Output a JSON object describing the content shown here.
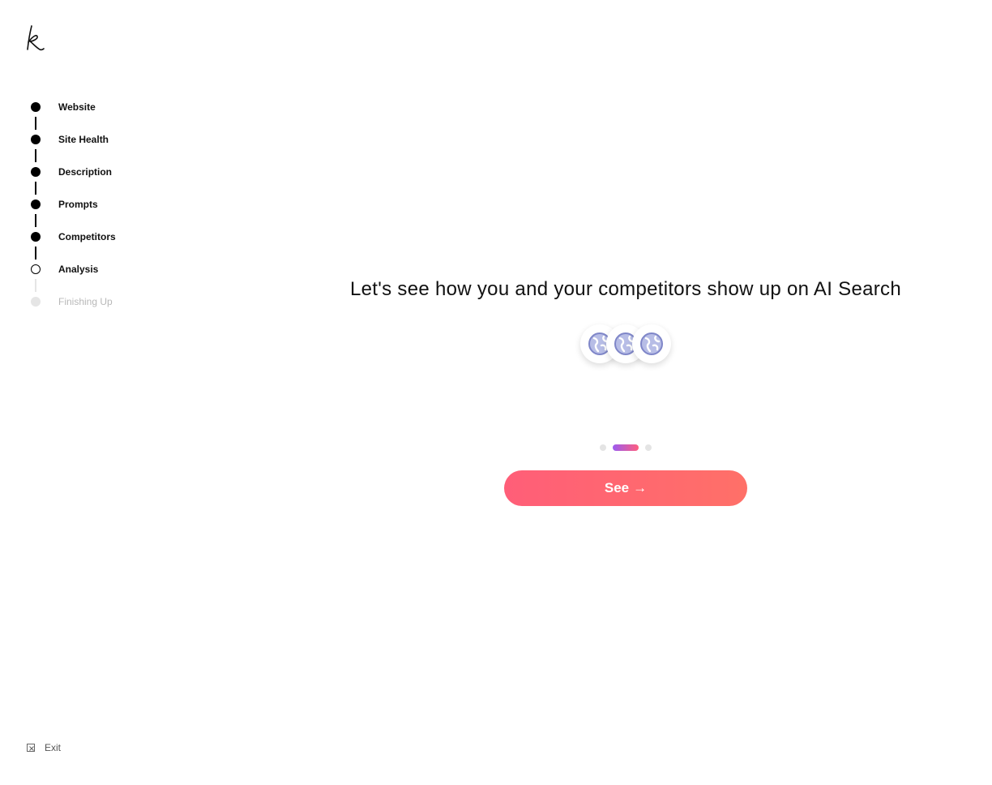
{
  "sidebar": {
    "logo": "k",
    "steps": [
      {
        "label": "Website",
        "status": "done"
      },
      {
        "label": "Site Health",
        "status": "done"
      },
      {
        "label": "Description",
        "status": "done"
      },
      {
        "label": "Prompts",
        "status": "done"
      },
      {
        "label": "Competitors",
        "status": "done"
      },
      {
        "label": "Analysis",
        "status": "current"
      },
      {
        "label": "Finishing Up",
        "status": "pending"
      }
    ],
    "exit_label": "Exit"
  },
  "main": {
    "headline": "Let's see how you and your competitors show up on AI Search",
    "icons": [
      "globe-icon",
      "globe-icon",
      "globe-icon"
    ],
    "pagination": {
      "total": 3,
      "active_index": 1
    },
    "cta_label": "See",
    "cta_arrow": "→"
  },
  "colors": {
    "accent_start": "#ff5e78",
    "accent_end": "#ff7068",
    "indicator_start": "#9b5cf0",
    "globe": "#7f86c8"
  }
}
